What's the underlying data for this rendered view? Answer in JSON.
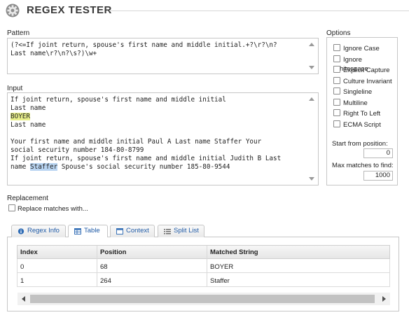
{
  "header": {
    "title": "REGEX TESTER",
    "icon": "gear-icon"
  },
  "pattern": {
    "label": "Pattern",
    "value": "(?<=If joint return, spouse's first name and middle initial.+?\\r?\\n?\nLast name\\r?\\n?\\s?)\\w+"
  },
  "input": {
    "label": "Input",
    "segments": [
      {
        "text": "If joint return, spouse's first name and middle initial\nLast name\n",
        "highlight": "none"
      },
      {
        "text": "BOYER",
        "highlight": "yellow"
      },
      {
        "text": "\nLast name\n\nYour first name and middle initial Paul A Last name Staffer Your\nsocial security number 184-80-8799\nIf joint return, spouse's first name and middle initial Judith B Last\nname ",
        "highlight": "none"
      },
      {
        "text": "Staffer",
        "highlight": "blue"
      },
      {
        "text": " Spouse's social security number 185-80-9544",
        "highlight": "none"
      }
    ]
  },
  "options": {
    "label": "Options",
    "checkboxes": [
      {
        "label": "Ignore Case",
        "checked": false
      },
      {
        "label": "Ignore Whitespace",
        "checked": false
      },
      {
        "label": "Explicit Capture",
        "checked": false
      },
      {
        "label": "Culture Invariant",
        "checked": false
      },
      {
        "label": "Singleline",
        "checked": false
      },
      {
        "label": "Multiline",
        "checked": false
      },
      {
        "label": "Right To Left",
        "checked": false
      },
      {
        "label": "ECMA Script",
        "checked": false
      }
    ],
    "start_from": {
      "label": "Start from position:",
      "value": "0"
    },
    "max_matches": {
      "label": "Max matches to find:",
      "value": "1000"
    }
  },
  "replacement": {
    "label": "Replacement",
    "checkbox_label": "Replace matches with...",
    "checked": false
  },
  "tabs": [
    {
      "label": "Regex Info",
      "icon": "info-icon",
      "active": false
    },
    {
      "label": "Table",
      "icon": "table-icon",
      "active": true
    },
    {
      "label": "Context",
      "icon": "context-icon",
      "active": false
    },
    {
      "label": "Split List",
      "icon": "list-icon",
      "active": false
    }
  ],
  "table": {
    "columns": [
      "Index",
      "Position",
      "Matched String"
    ],
    "rows": [
      [
        "0",
        "68",
        "BOYER"
      ],
      [
        "1",
        "264",
        "Staffer"
      ]
    ]
  },
  "colors": {
    "highlight_yellow": "#e9f08a",
    "highlight_blue": "#b9d5f2",
    "tab_text": "#1f5aa6"
  }
}
